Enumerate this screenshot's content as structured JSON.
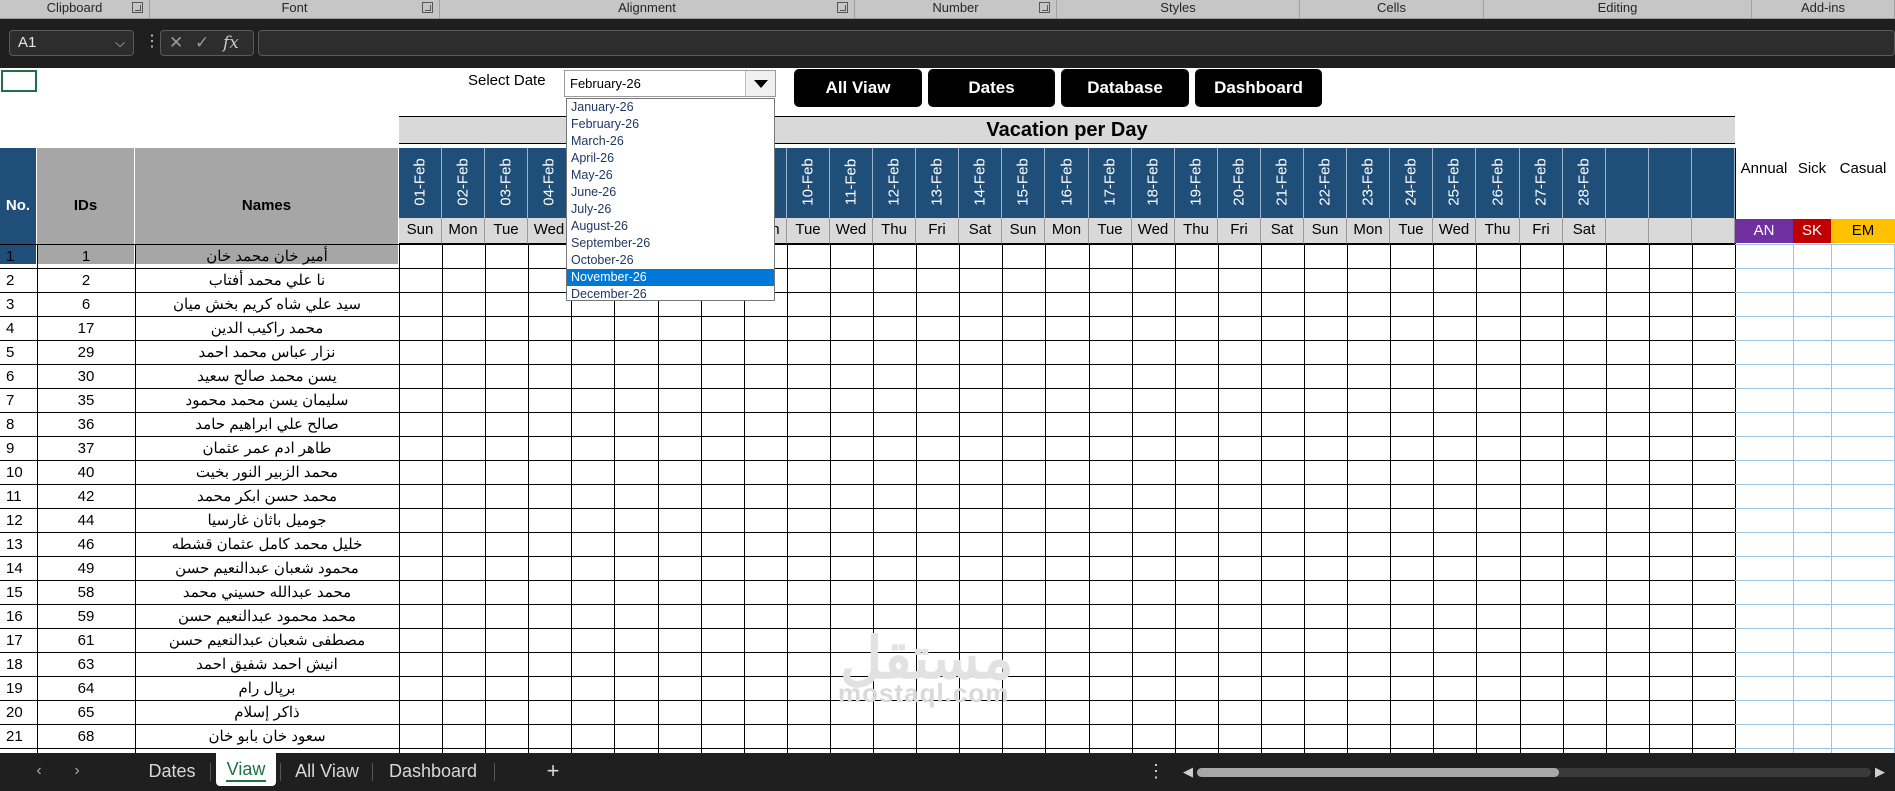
{
  "ribbon": {
    "groups": [
      {
        "label": "Clipboard",
        "launcher": true
      },
      {
        "label": "Font",
        "launcher": true
      },
      {
        "label": "Alignment",
        "launcher": true
      },
      {
        "label": "Number",
        "launcher": true
      },
      {
        "label": "Styles",
        "launcher": false
      },
      {
        "label": "Cells",
        "launcher": false
      },
      {
        "label": "Editing",
        "launcher": false
      },
      {
        "label": "Add-ins",
        "launcher": false
      }
    ]
  },
  "formula_bar": {
    "name_box": "A1",
    "cancel_icon": "✕",
    "enter_icon": "✓",
    "function_icon": "fx",
    "formula_value": ""
  },
  "controls": {
    "select_date_label": "Select Date",
    "selected_month": "February-26",
    "months": [
      "January-26",
      "February-26",
      "March-26",
      "April-26",
      "May-26",
      "June-26",
      "July-26",
      "August-26",
      "September-26",
      "October-26",
      "November-26",
      "December-26"
    ],
    "highlighted_month": "November-26",
    "buttons": [
      "All Viaw",
      "Dates",
      "Database",
      "Dashboard"
    ]
  },
  "sheet": {
    "title": "Vacation per Day",
    "col_no": "No.",
    "col_ids": "IDs",
    "col_names": "Names",
    "dates": [
      "01-Feb",
      "02-Feb",
      "03-Feb",
      "04-Feb",
      "05-Feb",
      "06-Feb",
      "07-Feb",
      "08-Feb",
      "09-Feb",
      "10-Feb",
      "11-Feb",
      "12-Feb",
      "13-Feb",
      "14-Feb",
      "15-Feb",
      "16-Feb",
      "17-Feb",
      "18-Feb",
      "19-Feb",
      "20-Feb",
      "21-Feb",
      "22-Feb",
      "23-Feb",
      "24-Feb",
      "25-Feb",
      "26-Feb",
      "27-Feb",
      "28-Feb"
    ],
    "days": [
      "Sun",
      "Mon",
      "Tue",
      "Wed",
      "Thu",
      "Fri",
      "Sat",
      "Sun",
      "Mon",
      "Tue",
      "Wed",
      "Thu",
      "Fri",
      "Sat",
      "Sun",
      "Mon",
      "Tue",
      "Wed",
      "Thu",
      "Fri",
      "Sat",
      "Sun",
      "Mon",
      "Tue",
      "Wed",
      "Thu",
      "Fri",
      "Sat"
    ],
    "summary": [
      {
        "label": "Annual",
        "code": "AN",
        "bg": "#7030a0",
        "fg": "#ffffff"
      },
      {
        "label": "Sick",
        "code": "SK",
        "bg": "#c00000",
        "fg": "#ffffff"
      },
      {
        "label": "Casual",
        "code": "EM",
        "bg": "#ffc000",
        "fg": "#000000"
      }
    ],
    "rows": [
      {
        "no": "1",
        "id": "1",
        "name": "أمير خان محمد خان"
      },
      {
        "no": "2",
        "id": "2",
        "name": "نا علي محمد أفتاب"
      },
      {
        "no": "3",
        "id": "6",
        "name": "سيد علي شاه كريم بخش ميان"
      },
      {
        "no": "4",
        "id": "17",
        "name": "محمد راكيب الدين"
      },
      {
        "no": "5",
        "id": "29",
        "name": "نزار عباس محمد احمد"
      },
      {
        "no": "6",
        "id": "30",
        "name": "يسن محمد صالح سعيد"
      },
      {
        "no": "7",
        "id": "35",
        "name": "سليمان يسن محمد محمود"
      },
      {
        "no": "8",
        "id": "36",
        "name": "صالح علي ابراهيم حامد"
      },
      {
        "no": "9",
        "id": "37",
        "name": "طاهر ادم عمر عثمان"
      },
      {
        "no": "10",
        "id": "40",
        "name": "محمد الزبير النور بخيت"
      },
      {
        "no": "11",
        "id": "42",
        "name": "محمد حسن ابكر محمد"
      },
      {
        "no": "12",
        "id": "44",
        "name": "جوميل باثان غارسيا"
      },
      {
        "no": "13",
        "id": "46",
        "name": "خليل محمد كامل عثمان قشطه"
      },
      {
        "no": "14",
        "id": "49",
        "name": "محمود شعبان عبدالنعيم حسن"
      },
      {
        "no": "15",
        "id": "58",
        "name": "محمد عبدالله حسيني محمد"
      },
      {
        "no": "16",
        "id": "59",
        "name": "محمد محمود عبدالنعيم حسن"
      },
      {
        "no": "17",
        "id": "61",
        "name": "مصطفى شعبان عبدالنعيم حسن"
      },
      {
        "no": "18",
        "id": "63",
        "name": "انيش احمد شفيق احمد"
      },
      {
        "no": "19",
        "id": "64",
        "name": "برپال رام"
      },
      {
        "no": "20",
        "id": "65",
        "name": "ذاكر إسلام"
      },
      {
        "no": "21",
        "id": "68",
        "name": "سعود خان بابو خان"
      }
    ]
  },
  "tabs": {
    "items": [
      "Dates",
      "Viaw",
      "All Viaw",
      "Dashboard"
    ],
    "active": "Viaw",
    "add_icon": "+",
    "more_icon": "⋮"
  },
  "watermark": {
    "arabic": "مستقل",
    "latin": "mostaql.com"
  }
}
